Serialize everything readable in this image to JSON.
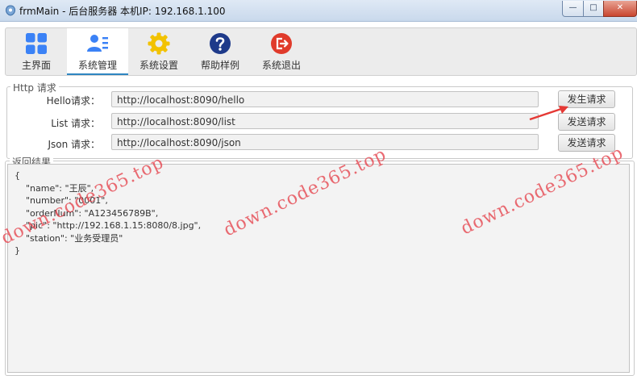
{
  "window": {
    "title": "frmMain - 后台服务器  本机IP: 192.168.1.100",
    "min_glyph": "—",
    "max_glyph": "□",
    "close_glyph": "✕"
  },
  "toolbar": {
    "items": [
      {
        "label": "主界面",
        "icon": "grid-icon",
        "color": "#3b82f6"
      },
      {
        "label": "系统管理",
        "icon": "user-list-icon",
        "color": "#3b82f6"
      },
      {
        "label": "系统设置",
        "icon": "gear-icon",
        "color": "#f2c200"
      },
      {
        "label": "帮助样例",
        "icon": "help-icon",
        "color": "#1e3a8a"
      },
      {
        "label": "系统退出",
        "icon": "exit-icon",
        "color": "#e03b2b"
      }
    ],
    "active_index": 1
  },
  "http_group": {
    "title": "Http 请求",
    "rows": [
      {
        "label": "Hello请求：",
        "url": "http://localhost:8090/hello",
        "button": "发生请求"
      },
      {
        "label": "List 请求：",
        "url": "http://localhost:8090/list",
        "button": "发送请求"
      },
      {
        "label": "Json 请求：",
        "url": "http://localhost:8090/json",
        "button": "发送请求"
      }
    ]
  },
  "result_group": {
    "title": "返回结果",
    "text": "{\n    \"name\": \"王辰\",\n    \"number\": \"0001\",\n    \"orderNum\": \"A123456789B\",\n    \"pic\": \"http://192.168.1.15:8080/8.jpg\",\n    \"station\": \"业务受理员\"\n}"
  },
  "watermark": {
    "text": "down.code365.top",
    "color": "#e7515a"
  }
}
